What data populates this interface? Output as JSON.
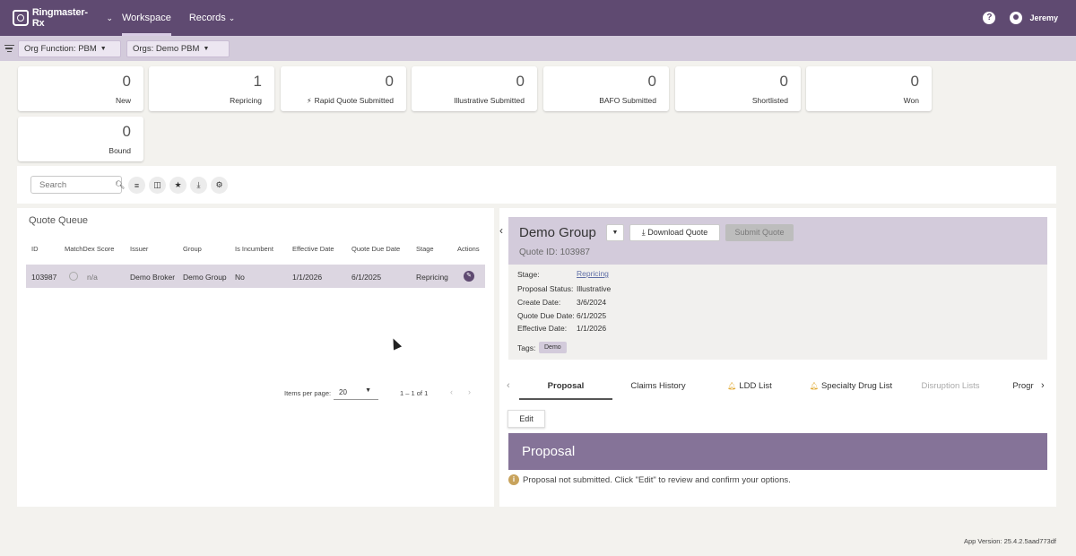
{
  "app": {
    "name": "Ringmaster-Rx",
    "nav": {
      "workspace": "Workspace",
      "records": "Records"
    },
    "user": "Jeremy"
  },
  "filters": {
    "org_function": "Org Function: PBM",
    "orgs": "Orgs: Demo PBM"
  },
  "stats": [
    {
      "value": "0",
      "label": "New"
    },
    {
      "value": "1",
      "label": "Repricing"
    },
    {
      "value": "0",
      "label": "Rapid Quote Submitted"
    },
    {
      "value": "0",
      "label": "Illustrative Submitted"
    },
    {
      "value": "0",
      "label": "BAFO Submitted"
    },
    {
      "value": "0",
      "label": "Shortlisted"
    },
    {
      "value": "0",
      "label": "Won"
    },
    {
      "value": "0",
      "label": "Bound"
    }
  ],
  "toolbar": {
    "search_placeholder": "Search"
  },
  "queue": {
    "title": "Quote Queue",
    "columns": [
      "ID",
      "MatchDex Score",
      "Issuer",
      "Group",
      "Is Incumbent",
      "Effective Date",
      "Quote Due Date",
      "Stage",
      "Actions"
    ],
    "rows": [
      {
        "id": "103987",
        "score": "n/a",
        "issuer": "Demo Broker",
        "group": "Demo Group",
        "incumbent": "No",
        "effective": "1/1/2026",
        "due": "6/1/2025",
        "stage": "Repricing"
      }
    ],
    "pager": {
      "items_label": "Items per page:",
      "per_page": "20",
      "range": "1 – 1 of 1"
    }
  },
  "detail": {
    "group": "Demo Group",
    "quote_id": "Quote ID: 103987",
    "download_label": "Download Quote",
    "submit_label": "Submit Quote",
    "fields": {
      "stage_label": "Stage:",
      "stage": "Repricing",
      "status_label": "Proposal Status:",
      "status": "Illustrative",
      "create_label": "Create Date:",
      "create": "3/6/2024",
      "due_label": "Quote Due Date:",
      "due": "6/1/2025",
      "effective_label": "Effective Date:",
      "effective": "1/1/2026",
      "tags_label": "Tags:",
      "tag": "Demo"
    },
    "tabs": [
      "Proposal",
      "Claims History",
      "LDD List",
      "Specialty Drug List",
      "Disruption Lists",
      "Progr"
    ],
    "edit_label": "Edit",
    "proposal_title": "Proposal",
    "notice": "Proposal not submitted. Click \"Edit\" to review and confirm your options."
  },
  "footer": {
    "version": "App Version: 25.4.2.5aad773df"
  }
}
